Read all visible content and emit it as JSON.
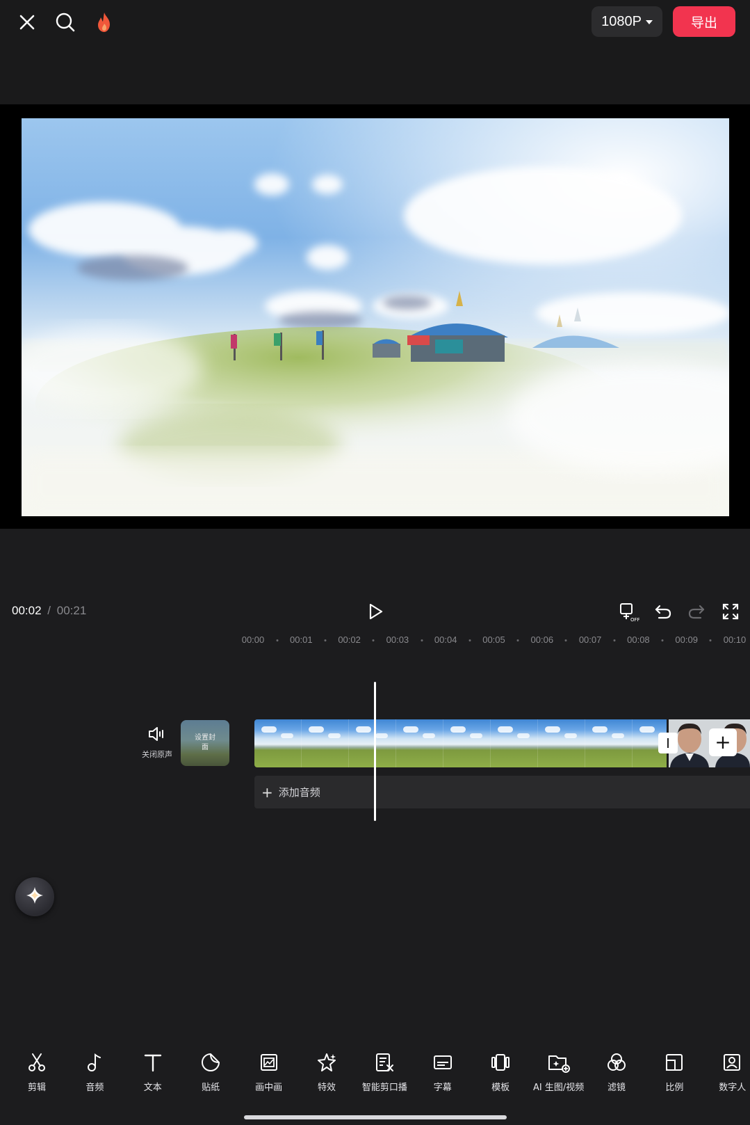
{
  "header": {
    "close_icon": "close-icon",
    "search_icon": "search-icon",
    "hot_icon": "flame-icon",
    "resolution_label": "1080P",
    "export_label": "导出"
  },
  "colors": {
    "accent_export": "#f2344f",
    "background": "#1c1c1e",
    "flame": "#f0573a"
  },
  "player": {
    "current_time": "00:02",
    "separator": "/",
    "total_time": "00:21",
    "icons": [
      "play-icon",
      "keyframe-off-icon",
      "undo-icon",
      "redo-icon",
      "fullscreen-icon"
    ]
  },
  "timeline": {
    "ruler_ticks": [
      "00:00",
      "00:01",
      "00:02",
      "00:03",
      "00:04",
      "00:05",
      "00:06",
      "00:07",
      "00:08",
      "00:09",
      "00:10"
    ],
    "mute_label": "关闭原声",
    "cover_label": "设置封面",
    "add_audio_label": "添加音频",
    "add_clip_symbol": "+",
    "playhead_time": "00:02"
  },
  "toolbar": {
    "items": [
      {
        "label": "剪辑",
        "icon": "scissors-icon"
      },
      {
        "label": "音频",
        "icon": "music-note-icon"
      },
      {
        "label": "文本",
        "icon": "text-icon"
      },
      {
        "label": "贴纸",
        "icon": "sticker-icon"
      },
      {
        "label": "画中画",
        "icon": "picture-in-picture-icon"
      },
      {
        "label": "特效",
        "icon": "effects-star-icon"
      },
      {
        "label": "智能剪口播",
        "icon": "smart-cut-icon"
      },
      {
        "label": "字幕",
        "icon": "subtitle-icon"
      },
      {
        "label": "模板",
        "icon": "template-icon"
      },
      {
        "label": "AI 生图/视频",
        "icon": "ai-generate-icon"
      },
      {
        "label": "滤镜",
        "icon": "filter-icon"
      },
      {
        "label": "比例",
        "icon": "ratio-icon"
      },
      {
        "label": "数字人",
        "icon": "digital-human-icon"
      }
    ]
  }
}
